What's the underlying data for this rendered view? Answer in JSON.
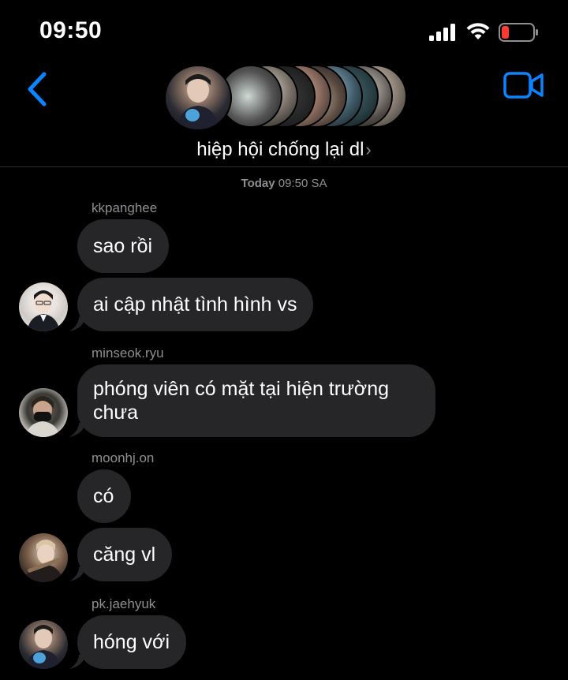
{
  "status_bar": {
    "time": "09:50"
  },
  "header": {
    "group_name": "hiệp hội chống lại dl",
    "chevron": "›",
    "back_icon": "chevron-left-icon",
    "video_icon": "video-camera-icon"
  },
  "conversation": {
    "timestamp_day": "Today",
    "timestamp_time": "09:50 SA",
    "messages": [
      {
        "sender": "kkpanghee",
        "text": "sao rồi"
      },
      {
        "sender": "",
        "text": "ai cập nhật tình hình vs"
      },
      {
        "sender": "minseok.ryu",
        "text": "phóng viên có mặt tại hiện trường chưa"
      },
      {
        "sender": "moonhj.on",
        "text": "có"
      },
      {
        "sender": "",
        "text": "căng vl"
      },
      {
        "sender": "pk.jaehyuk",
        "text": "hóng với"
      }
    ]
  },
  "colors": {
    "background": "#000000",
    "bubble": "#262628",
    "accent": "#0a84ff",
    "secondary_text": "#8e8e93",
    "battery_low": "#ff3b30"
  }
}
